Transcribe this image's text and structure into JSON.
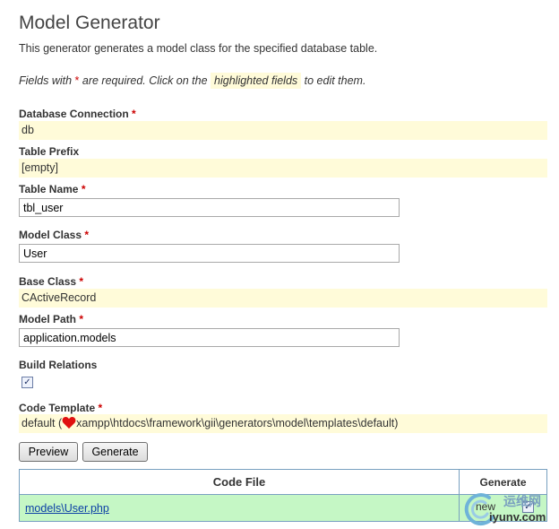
{
  "header": {
    "title": "Model Generator",
    "intro": "This generator generates a model class for the specified database table."
  },
  "note": {
    "prefix": "Fields with",
    "asterisk": "*",
    "middle": "are required. Click on the",
    "highlighted": "highlighted fields",
    "suffix": "to edit them."
  },
  "form": {
    "required_marker": "*",
    "db_connection": {
      "label": "Database Connection",
      "value": "db"
    },
    "table_prefix": {
      "label": "Table Prefix",
      "value": "[empty]"
    },
    "table_name": {
      "label": "Table Name",
      "value": "tbl_user"
    },
    "model_class": {
      "label": "Model Class",
      "value": "User"
    },
    "base_class": {
      "label": "Base Class",
      "value": "CActiveRecord"
    },
    "model_path": {
      "label": "Model Path",
      "value": "application.models"
    },
    "build_relations": {
      "label": "Build Relations",
      "checked": true
    },
    "code_template": {
      "label": "Code Template",
      "value_prefix": "default (",
      "value_suffix": "xampp\\htdocs\\framework\\gii\\generators\\model\\templates\\default)"
    }
  },
  "buttons": {
    "preview": "Preview",
    "generate": "Generate"
  },
  "table": {
    "headers": {
      "code_file": "Code File",
      "generate": "Generate"
    },
    "rows": [
      {
        "file": "models\\User.php",
        "status": "new",
        "checked": true
      }
    ]
  },
  "watermark": {
    "cn": "运维网",
    "en": "iyunv.com"
  },
  "colors": {
    "sticky_bg": "#fffbd9",
    "row_bg": "#c5f7c5",
    "required": "#cc0000",
    "link": "#0b3fa5"
  }
}
